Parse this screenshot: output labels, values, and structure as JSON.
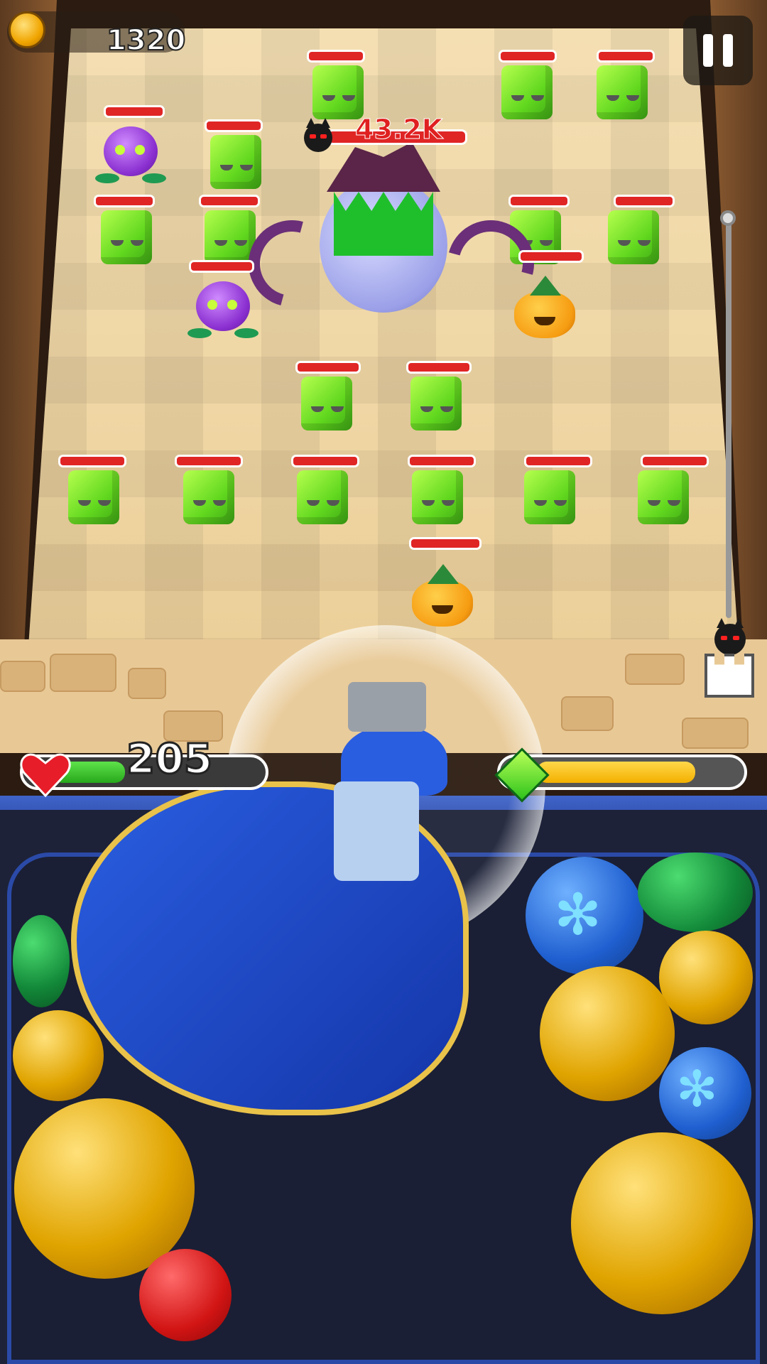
{
  "hud": {
    "coins": "1320",
    "health": "205",
    "health_fraction": 0.35,
    "energy_fraction": 0.78
  },
  "boss": {
    "damage_label": "43.2K"
  },
  "colors": {
    "hp_bar": "#e02525",
    "health_bar": "#27a81c",
    "energy_bar": "#f3b000"
  },
  "icons": [
    "coin-icon",
    "pause-icon",
    "heart-icon",
    "gem-icon",
    "devil-icon",
    "castle-icon"
  ]
}
